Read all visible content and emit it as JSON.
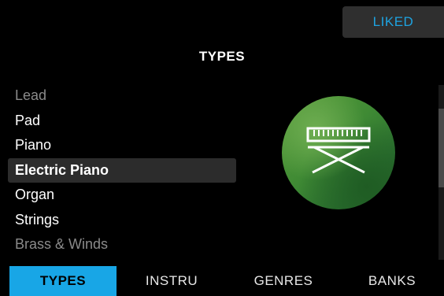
{
  "header": {
    "liked_label": "LIKED",
    "title": "TYPES"
  },
  "types": [
    {
      "label": "Lead",
      "state": "dim"
    },
    {
      "label": "Pad",
      "state": "normal"
    },
    {
      "label": "Piano",
      "state": "normal"
    },
    {
      "label": "Electric Piano",
      "state": "selected"
    },
    {
      "label": "Organ",
      "state": "normal"
    },
    {
      "label": "Strings",
      "state": "normal"
    },
    {
      "label": "Brass & Winds",
      "state": "dim"
    }
  ],
  "selected_type_icon": "keyboard-on-stand-icon",
  "tabs": [
    {
      "label": "TYPES",
      "active": true
    },
    {
      "label": "INSTRU",
      "active": false
    },
    {
      "label": "GENRES",
      "active": false
    },
    {
      "label": "BANKS",
      "active": false
    }
  ],
  "colors": {
    "accent": "#18a6e6",
    "liked_text": "#1ea3e0",
    "selected_row_bg": "#2c2c2c",
    "dim_text": "#8a8a8a"
  }
}
